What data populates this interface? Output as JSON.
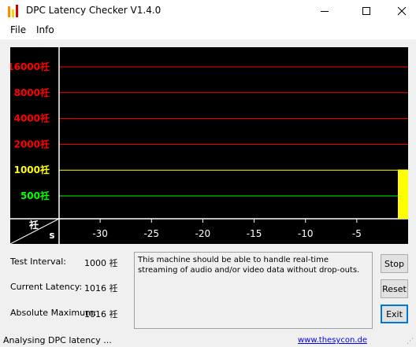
{
  "window": {
    "title": "DPC Latency Checker V1.4.0"
  },
  "menu": {
    "items": [
      "File",
      "Info"
    ]
  },
  "chart_data": {
    "type": "bar",
    "y_axis": {
      "scale": "log",
      "unit_glyph": "祍",
      "ticks": [
        {
          "label": "16000祍",
          "value": 16000,
          "color": "#ff0000"
        },
        {
          "label": "8000祍",
          "value": 8000,
          "color": "#ff0000"
        },
        {
          "label": "4000祍",
          "value": 4000,
          "color": "#ff0000"
        },
        {
          "label": "2000祍",
          "value": 2000,
          "color": "#ff0000"
        },
        {
          "label": "1000祍",
          "value": 1000,
          "color": "#ffff00"
        },
        {
          "label": "500祍",
          "value": 500,
          "color": "#00ff00"
        }
      ]
    },
    "x_axis": {
      "unit_label": "s",
      "ticks": [
        -30,
        -25,
        -20,
        -15,
        -10,
        -5
      ],
      "range": [
        -34,
        0
      ]
    },
    "corner_label": "祍",
    "series": [
      {
        "x": [
          -0.5
        ],
        "values": [
          1016
        ],
        "color": "#ffff00"
      }
    ],
    "background": "#000000",
    "grid": true
  },
  "stats": {
    "test_interval": {
      "label": "Test Interval:",
      "value": "1000 祍"
    },
    "current_latency": {
      "label": "Current Latency:",
      "value": "1016 祍"
    },
    "absolute_maximum": {
      "label": "Absolute Maximum:",
      "value": "1016 祍"
    }
  },
  "message": "This machine should be able to handle real-time streaming of audio and/or video data without drop-outs.",
  "buttons": {
    "stop": "Stop",
    "reset": "Reset",
    "exit": "Exit"
  },
  "status": {
    "text": "Analysing DPC latency ...",
    "link": "www.thesycon.de"
  }
}
